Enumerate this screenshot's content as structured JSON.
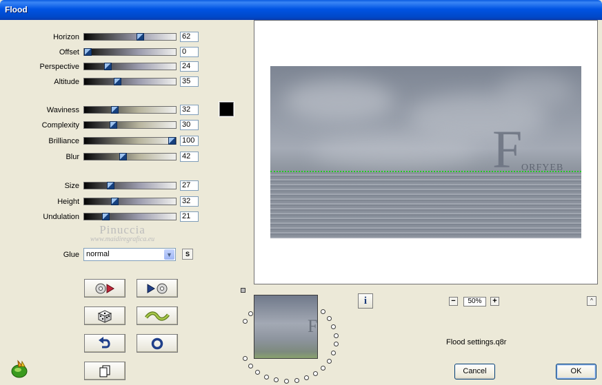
{
  "window": {
    "title": "Flood"
  },
  "sliders": [
    {
      "label": "Horizon",
      "value": "62",
      "level": 62,
      "tint": "#9c9cae"
    },
    {
      "label": "Offset",
      "value": "0",
      "level": 0,
      "tint": "#9c9cae"
    },
    {
      "label": "Perspective",
      "value": "24",
      "level": 24,
      "tint": "#9c9cae"
    },
    {
      "label": "Altitude",
      "value": "35",
      "level": 35,
      "tint": "#9c9cae"
    },
    {
      "label": "Waviness",
      "value": "32",
      "level": 32,
      "tint": "#b8b59e"
    },
    {
      "label": "Complexity",
      "value": "30",
      "level": 30,
      "tint": "#b8b59e"
    },
    {
      "label": "Brilliance",
      "value": "100",
      "level": 100,
      "tint": "#b8b59e"
    },
    {
      "label": "Blur",
      "value": "42",
      "level": 42,
      "tint": "#b8b59e"
    },
    {
      "label": "Size",
      "value": "27",
      "level": 27,
      "tint": "#9c9cae"
    },
    {
      "label": "Height",
      "value": "32",
      "level": 32,
      "tint": "#9c9cae"
    },
    {
      "label": "Undulation",
      "value": "21",
      "level": 21,
      "tint": "#9c9cae"
    }
  ],
  "color_swatch": "#000000",
  "watermark": {
    "name": "Pinuccia",
    "url": "www.maidiregrafica.eu"
  },
  "glue": {
    "label": "Glue",
    "value": "normal",
    "s_button": "S"
  },
  "tool_buttons": [
    {
      "name": "load-preset-button",
      "icon": "disc-arrow-in-icon"
    },
    {
      "name": "save-preset-button",
      "icon": "arrow-disc-out-icon"
    },
    {
      "name": "random-button",
      "icon": "dice-icon"
    },
    {
      "name": "mutate-button",
      "icon": "wave-icon"
    },
    {
      "name": "undo-button",
      "icon": "undo-arrow-icon"
    },
    {
      "name": "reset-button",
      "icon": "ring-icon"
    },
    {
      "name": "copy-button",
      "icon": "pages-icon"
    }
  ],
  "preview": {
    "text_big": "F",
    "text_small": "ORFYEB",
    "thumb_text": "F"
  },
  "zoom": {
    "minus": "−",
    "value": "50%",
    "plus": "+"
  },
  "info_button": "i",
  "collapse_button": "^",
  "settings_file": "Flood settings.q8r",
  "buttons": {
    "cancel": "Cancel",
    "ok": "OK"
  }
}
